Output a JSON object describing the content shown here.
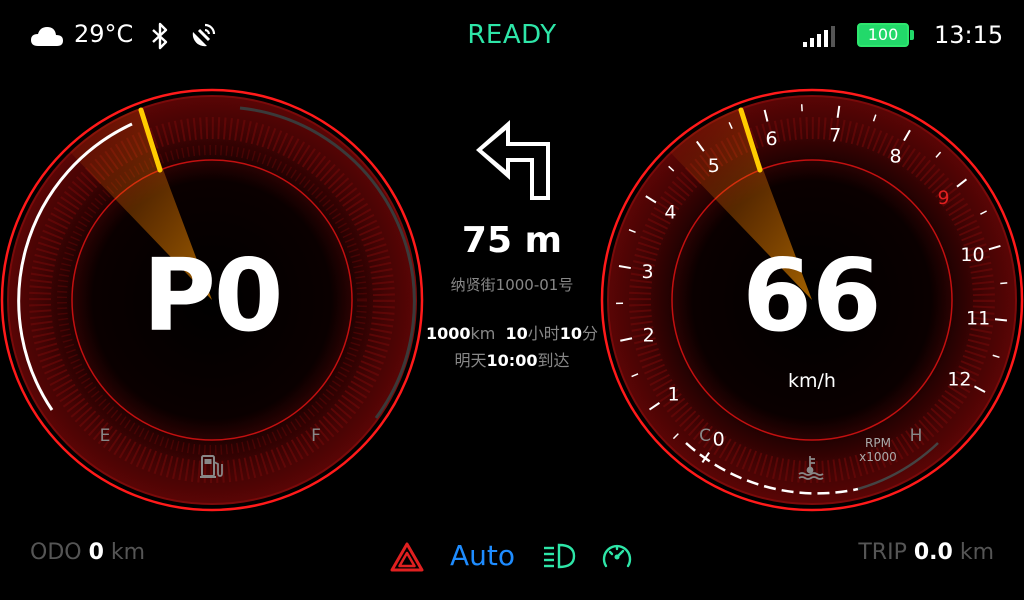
{
  "status_bar": {
    "weather_icon": "cloud-icon",
    "temperature": "29°C",
    "bluetooth_icon": "bluetooth-icon",
    "satellite_icon": "satellite-icon",
    "ready_text": "READY",
    "signal_icon": "signal-bars-icon",
    "battery_percent": "100",
    "time": "13:15"
  },
  "left_gauge": {
    "gear": "P0",
    "fuel_empty_label": "E",
    "fuel_full_label": "F",
    "fuel_icon": "fuel-pump-icon"
  },
  "right_gauge": {
    "speed": "66",
    "speed_unit": "km/h",
    "rpm_ticks": [
      "0",
      "1",
      "2",
      "3",
      "4",
      "5",
      "6",
      "7",
      "8",
      "9",
      "10",
      "11",
      "12"
    ],
    "rpm_redline_tick": "9",
    "rpm_unit_line1": "RPM",
    "rpm_unit_line2": "x1000",
    "temp_cold_label": "C",
    "temp_hot_label": "H",
    "temp_icon": "coolant-temperature-icon"
  },
  "navigation": {
    "turn_icon": "turn-left-arrow-icon",
    "distance": "75 m",
    "street": "纳贤街1000-01号",
    "remaining_distance_value": "1000",
    "remaining_distance_unit": "km",
    "remaining_hours_value": "10",
    "remaining_hours_unit": "小时",
    "remaining_minutes_value": "10",
    "remaining_minutes_unit": "分",
    "arrival_prefix": "明天",
    "arrival_time": "10:00",
    "arrival_suffix": "到达"
  },
  "bottom_bar": {
    "odo_label": "ODO",
    "odo_value": "0",
    "odo_unit": "km",
    "hazard_icon": "hazard-warning-icon",
    "auto_label": "Auto",
    "headlight_icon": "headlight-icon",
    "cruise_icon": "cruise-control-icon",
    "trip_label": "TRIP",
    "trip_value": "0.0",
    "trip_unit": "km"
  },
  "colors": {
    "ready": "#2ee6a8",
    "battery": "#22d96a",
    "accent_red": "#e02020",
    "needle": "#ffcc00",
    "auto_blue": "#1e8cff",
    "headlight_green": "#2ee6a8"
  }
}
